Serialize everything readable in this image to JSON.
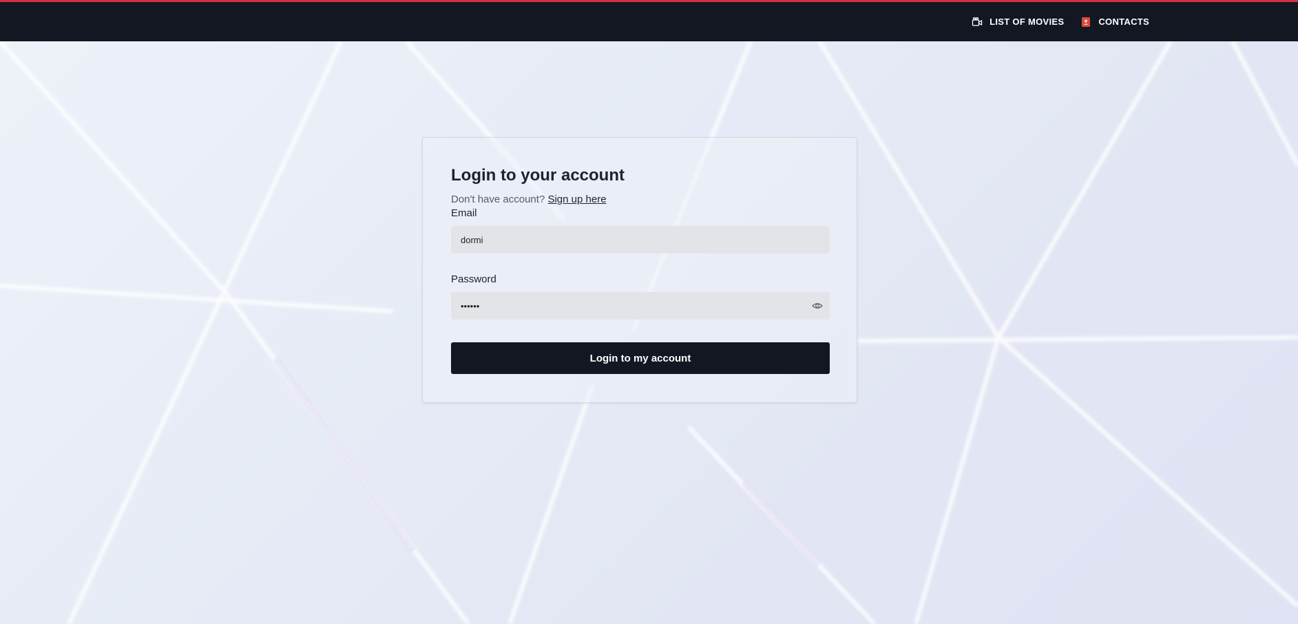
{
  "nav": {
    "movies_label": "LIST OF MOVIES",
    "movies_icon": "video-camera-icon",
    "contacts_label": "CONTACTS",
    "contacts_icon": "contact-book-icon",
    "accent_color": "#d32f3f"
  },
  "login": {
    "title": "Login to your account",
    "signup_prompt": "Don't have account?",
    "signup_link": "Sign up here",
    "email_label": "Email",
    "email_value": "dormi",
    "password_label": "Password",
    "password_value": "••••••",
    "password_toggle_icon": "eye-icon",
    "submit_label": "Login to my account"
  }
}
